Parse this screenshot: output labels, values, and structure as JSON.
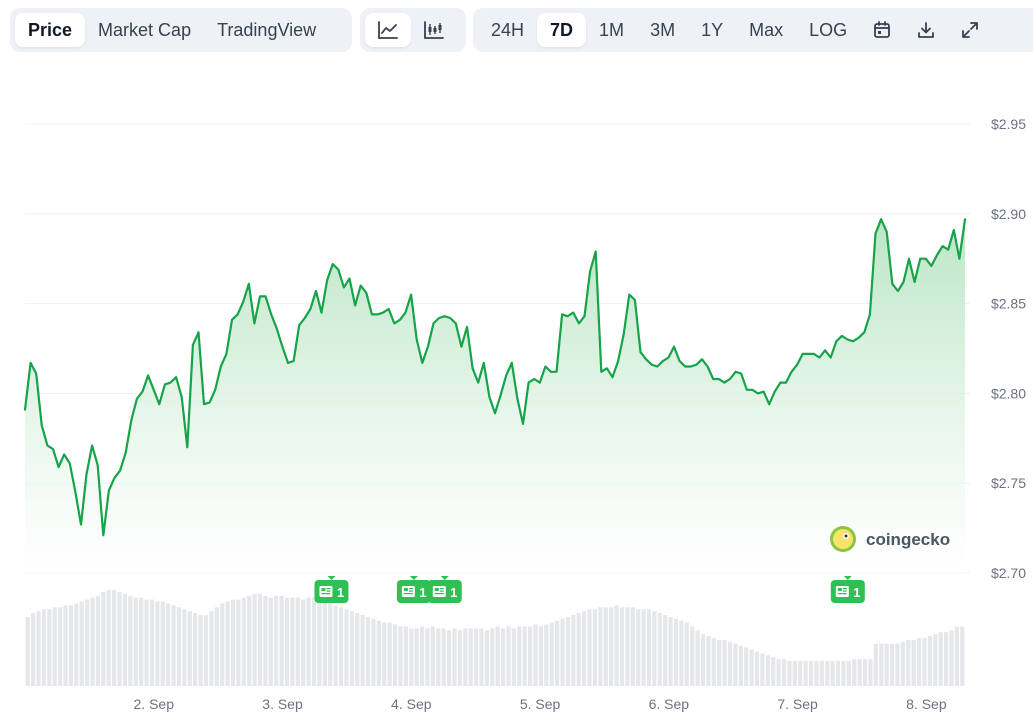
{
  "toolbar": {
    "chart_types": [
      "Price",
      "Market Cap",
      "TradingView"
    ],
    "active_chart_type": "Price",
    "views": [
      {
        "icon": "line-chart-icon",
        "active": true
      },
      {
        "icon": "candlestick-chart-icon",
        "active": false
      }
    ],
    "ranges": [
      "24H",
      "7D",
      "1M",
      "3M",
      "1Y",
      "Max",
      "LOG"
    ],
    "active_range": "7D",
    "actions": [
      "calendar-icon",
      "download-icon",
      "expand-icon"
    ]
  },
  "watermark": "coingecko",
  "colors": {
    "line": "#16a34a",
    "fill_top": "#b7e4c2",
    "volume": "#e5e7eb",
    "badge": "#2fbf55",
    "grid": "#eef0f3"
  },
  "chart_data": {
    "type": "area",
    "title": "",
    "xlabel": "",
    "ylabel": "",
    "x_ticks": [
      {
        "label": "2. Sep",
        "day": 1
      },
      {
        "label": "3. Sep",
        "day": 2
      },
      {
        "label": "4. Sep",
        "day": 3
      },
      {
        "label": "5. Sep",
        "day": 4
      },
      {
        "label": "6. Sep",
        "day": 5
      },
      {
        "label": "7. Sep",
        "day": 6
      },
      {
        "label": "8. Sep",
        "day": 7
      }
    ],
    "y_ticks": [
      "$2.95",
      "$2.90",
      "$2.85",
      "$2.80",
      "$2.75",
      "$2.70"
    ],
    "y_tick_values": [
      2.95,
      2.9,
      2.85,
      2.8,
      2.75,
      2.7
    ],
    "ylim": [
      2.7,
      2.95
    ],
    "xlim": [
      0.0,
      7.3
    ],
    "grid": true,
    "series": [
      {
        "values": [
          2.791,
          2.817,
          2.811,
          2.782,
          2.771,
          2.769,
          2.759,
          2.766,
          2.761,
          2.745,
          2.727,
          2.755,
          2.771,
          2.76,
          2.721,
          2.746,
          2.753,
          2.757,
          2.767,
          2.785,
          2.797,
          2.801,
          2.81,
          2.802,
          2.794,
          2.805,
          2.806,
          2.809,
          2.798,
          2.77,
          2.827,
          2.834,
          2.794,
          2.795,
          2.802,
          2.815,
          2.822,
          2.841,
          2.844,
          2.851,
          2.861,
          2.839,
          2.854,
          2.854,
          2.844,
          2.836,
          2.826,
          2.817,
          2.818,
          2.838,
          2.842,
          2.847,
          2.857,
          2.845,
          2.863,
          2.872,
          2.869,
          2.859,
          2.864,
          2.849,
          2.86,
          2.856,
          2.844,
          2.844,
          2.845,
          2.847,
          2.839,
          2.841,
          2.845,
          2.855,
          2.83,
          2.817,
          2.826,
          2.839,
          2.842,
          2.843,
          2.842,
          2.839,
          2.826,
          2.837,
          2.814,
          2.806,
          2.817,
          2.798,
          2.789,
          2.799,
          2.81,
          2.817,
          2.797,
          2.783,
          2.806,
          2.808,
          2.806,
          2.815,
          2.812,
          2.812,
          2.844,
          2.843,
          2.845,
          2.839,
          2.843,
          2.868,
          2.879,
          2.812,
          2.814,
          2.809,
          2.818,
          2.833,
          2.855,
          2.852,
          2.823,
          2.819,
          2.816,
          2.815,
          2.818,
          2.82,
          2.826,
          2.818,
          2.815,
          2.815,
          2.816,
          2.819,
          2.815,
          2.808,
          2.808,
          2.806,
          2.808,
          2.812,
          2.811,
          2.802,
          2.802,
          2.8,
          2.801,
          2.794,
          2.801,
          2.806,
          2.806,
          2.812,
          2.816,
          2.822,
          2.822,
          2.822,
          2.82,
          2.824,
          2.82,
          2.829,
          2.832,
          2.83,
          2.829,
          2.831,
          2.834,
          2.844,
          2.889,
          2.897,
          2.89,
          2.861,
          2.857,
          2.862,
          2.875,
          2.862,
          2.875,
          2.875,
          2.871,
          2.877,
          2.882,
          2.88,
          2.891,
          2.875,
          2.897
        ]
      }
    ],
    "volume_series": [
      0.36,
      0.38,
      0.39,
      0.4,
      0.4,
      0.41,
      0.41,
      0.42,
      0.42,
      0.43,
      0.44,
      0.45,
      0.46,
      0.47,
      0.49,
      0.5,
      0.5,
      0.49,
      0.48,
      0.47,
      0.46,
      0.46,
      0.45,
      0.45,
      0.44,
      0.44,
      0.43,
      0.42,
      0.41,
      0.4,
      0.39,
      0.38,
      0.37,
      0.37,
      0.39,
      0.41,
      0.43,
      0.44,
      0.45,
      0.45,
      0.46,
      0.47,
      0.48,
      0.48,
      0.47,
      0.46,
      0.47,
      0.47,
      0.46,
      0.46,
      0.46,
      0.45,
      0.46,
      0.46,
      0.45,
      0.44,
      0.43,
      0.42,
      0.41,
      0.4,
      0.39,
      0.38,
      0.37,
      0.36,
      0.35,
      0.34,
      0.33,
      0.33,
      0.32,
      0.31,
      0.31,
      0.3,
      0.3,
      0.31,
      0.3,
      0.31,
      0.3,
      0.3,
      0.29,
      0.3,
      0.29,
      0.3,
      0.3,
      0.3,
      0.3,
      0.29,
      0.3,
      0.31,
      0.3,
      0.31,
      0.3,
      0.31,
      0.31,
      0.31,
      0.32,
      0.31,
      0.32,
      0.33,
      0.34,
      0.35,
      0.36,
      0.37,
      0.38,
      0.39,
      0.4,
      0.4,
      0.41,
      0.41,
      0.41,
      0.42,
      0.41,
      0.41,
      0.41,
      0.4,
      0.4,
      0.4,
      0.39,
      0.38,
      0.37,
      0.36,
      0.35,
      0.34,
      0.33,
      0.31,
      0.29,
      0.27,
      0.26,
      0.25,
      0.24,
      0.24,
      0.23,
      0.22,
      0.21,
      0.2,
      0.19,
      0.18,
      0.17,
      0.16,
      0.15,
      0.14,
      0.14,
      0.13,
      0.13,
      0.13,
      0.13,
      0.13,
      0.13,
      0.13,
      0.13,
      0.13,
      0.13,
      0.13,
      0.13,
      0.14,
      0.14,
      0.14,
      0.14,
      0.22,
      0.22,
      0.22,
      0.22,
      0.22,
      0.23,
      0.24,
      0.24,
      0.25,
      0.25,
      0.26,
      0.27,
      0.28,
      0.28,
      0.29,
      0.31,
      0.31
    ],
    "news_markers": [
      {
        "x": 2.38,
        "count": "1"
      },
      {
        "x": 3.02,
        "count": "1"
      },
      {
        "x": 3.26,
        "count": "1"
      },
      {
        "x": 6.39,
        "count": "1"
      }
    ]
  }
}
